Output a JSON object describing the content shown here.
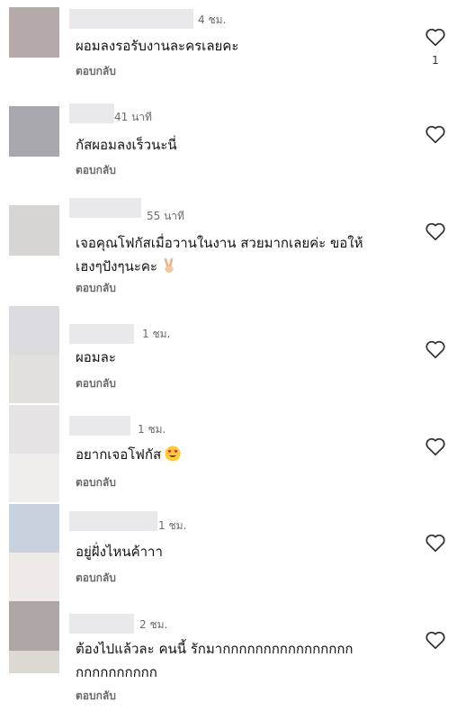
{
  "reply_label": "ตอบกลับ",
  "comments": [
    {
      "time": "4 ชม.",
      "text": "ผอมลงรอรับงานละครเลยคะ",
      "likes": "1"
    },
    {
      "time": "41 นาที",
      "text": "กัสผอมลงเร็วนะนี่"
    },
    {
      "time": "55 นาที",
      "text_line1": "เจอคุณโฟกัสเมื่อวานในงาน สวยมากเลยค่ะ ขอให้",
      "text_line2": "เฮงๆปังๆนะคะ",
      "emoji": "victory-hand-emoji"
    },
    {
      "time": "1 ชม.",
      "text": "ผอมละ"
    },
    {
      "time": "1 ชม.",
      "text": "อยากเจอโฟกัส",
      "emoji": "heart-eyes-emoji"
    },
    {
      "time": "1 ชม.",
      "text": "อยู่ฝั่งไหนค้าาา"
    },
    {
      "time": "2 ชม.",
      "text_line1": "ต้องไปแล้วละ คนนี้ รักมากกกกกกกกกกกกกกกก",
      "text_line2": "กกกกกกกกกก"
    }
  ],
  "colors": {
    "meta_text": "#6b6b6b",
    "name_blur": "#e9e9ec"
  }
}
